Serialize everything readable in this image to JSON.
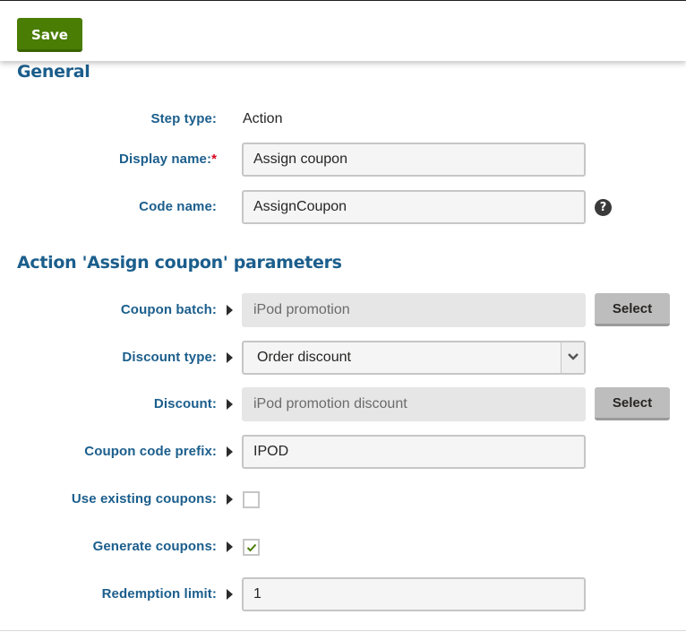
{
  "toolbar": {
    "save_label": "Save"
  },
  "general": {
    "title": "General",
    "step_type": {
      "label": "Step type:",
      "value": "Action"
    },
    "display_name": {
      "label": "Display name:",
      "required_mark": "*",
      "value": "Assign coupon"
    },
    "code_name": {
      "label": "Code name:",
      "value": "AssignCoupon",
      "help_icon": "question-circle-icon",
      "help_glyph": "?"
    }
  },
  "parameters": {
    "title": "Action 'Assign coupon' parameters",
    "coupon_batch": {
      "label": "Coupon batch:",
      "value": "iPod promotion",
      "button": "Select"
    },
    "discount_type": {
      "label": "Discount type:",
      "selected": "Order discount"
    },
    "discount": {
      "label": "Discount:",
      "value": "iPod promotion discount",
      "button": "Select"
    },
    "coupon_code_prefix": {
      "label": "Coupon code prefix:",
      "value": "IPOD"
    },
    "use_existing_coupons": {
      "label": "Use existing coupons:",
      "checked": false
    },
    "generate_coupons": {
      "label": "Generate coupons:",
      "checked": true
    },
    "redemption_limit": {
      "label": "Redemption limit:",
      "value": "1"
    }
  },
  "colors": {
    "primary_button": "#497d04",
    "heading": "#1b5e8c",
    "required": "#d6001c",
    "secondary_button": "#bebdbd",
    "check": "#497d04"
  }
}
